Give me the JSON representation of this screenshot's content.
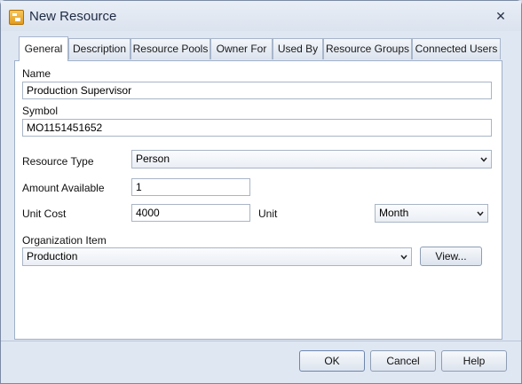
{
  "window": {
    "title": "New Resource"
  },
  "tabs": [
    {
      "label": "General"
    },
    {
      "label": "Description"
    },
    {
      "label": "Resource Pools"
    },
    {
      "label": "Owner For"
    },
    {
      "label": "Used By"
    },
    {
      "label": "Resource Groups"
    },
    {
      "label": "Connected Users"
    }
  ],
  "form": {
    "name": {
      "label": "Name",
      "value": "Production Supervisor"
    },
    "symbol": {
      "label": "Symbol",
      "value": "MO1151451652"
    },
    "resource_type": {
      "label": "Resource Type",
      "value": "Person"
    },
    "amount_available": {
      "label": "Amount Available",
      "value": "1"
    },
    "unit_cost": {
      "label": "Unit Cost",
      "value": "4000"
    },
    "unit": {
      "label": "Unit",
      "value": "Month"
    },
    "organization_item": {
      "label": "Organization Item",
      "value": "Production",
      "view_label": "View..."
    }
  },
  "buttons": {
    "ok": "OK",
    "cancel": "Cancel",
    "help": "Help"
  }
}
